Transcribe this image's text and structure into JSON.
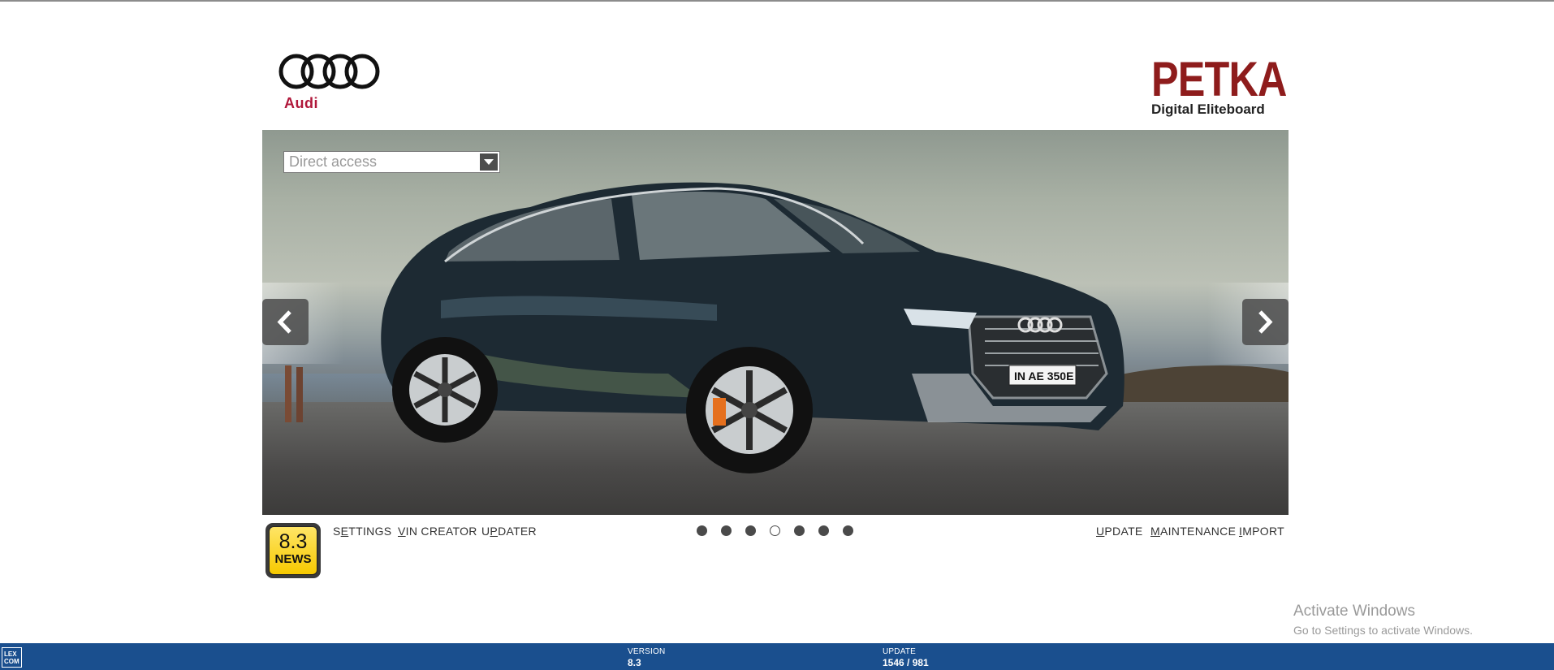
{
  "brand": {
    "audi_name": "Audi",
    "petka_title": "PETKA",
    "petka_subtitle": "Digital Eliteboard"
  },
  "search": {
    "placeholder": "Direct access"
  },
  "hero": {
    "license_plate": "IN AE 350E"
  },
  "nav_left": {
    "settings_pre": "S",
    "settings_u": "E",
    "settings_post": "TTINGS",
    "vin_u": "V",
    "vin_post": "IN CREATOR",
    "updater_pre": "U",
    "updater_u": "P",
    "updater_post": "DATER"
  },
  "nav_right": {
    "update_u": "U",
    "update_post": "PDATE",
    "maintenance_u": "M",
    "maintenance_post": "AINTENANCE",
    "import_u": "I",
    "import_post": "MPORT"
  },
  "news": {
    "version": "8.3",
    "label": "NEWS"
  },
  "carousel": {
    "total": 7,
    "active_index": 3
  },
  "watermark": {
    "line1": "Activate Windows",
    "line2": "Go to Settings to activate Windows."
  },
  "statusbar": {
    "logo_line1": "LEX",
    "logo_line2": "COM",
    "version_label": "VERSION",
    "version_value": "8.3",
    "update_label": "UPDATE",
    "update_value": "1546 / 981"
  },
  "colors": {
    "audi_red": "#b0173a",
    "petka_red": "#8e1c1c",
    "statusbar_blue": "#1a4f8e",
    "news_yellow": "#f6c900"
  }
}
